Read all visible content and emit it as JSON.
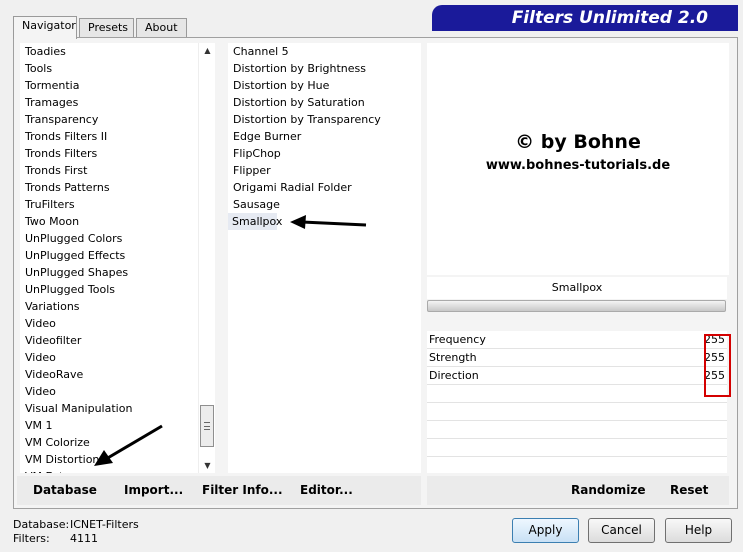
{
  "banner": {
    "title": "Filters Unlimited 2.0"
  },
  "tabs": [
    "Navigator",
    "Presets",
    "About"
  ],
  "categories": [
    "Toadies",
    "Tools",
    "Tormentia",
    "Tramages",
    "Transparency",
    "Tronds Filters II",
    "Tronds Filters",
    "Tronds First",
    "Tronds Patterns",
    "TruFilters",
    "Two Moon",
    "UnPlugged Colors",
    "UnPlugged Effects",
    "UnPlugged Shapes",
    "UnPlugged Tools",
    "Variations",
    "Video",
    "Videofilter",
    "Video",
    "VideoRave",
    "Video",
    "Visual Manipulation",
    "VM 1",
    "VM Colorize",
    "VM Distortion",
    "VM Extravaganza"
  ],
  "filters": [
    "Channel 5",
    "Distortion by Brightness",
    "Distortion by Hue",
    "Distortion by Saturation",
    "Distortion by Transparency",
    "Edge Burner",
    "FlipChop",
    "Flipper",
    "Origami Radial Folder",
    "Sausage",
    "Smallpox"
  ],
  "selected_filter": "Smallpox",
  "preview": {
    "copyright": "© by Bohne",
    "url": "www.bohnes-tutorials.de"
  },
  "filter_name_display": "Smallpox",
  "params": [
    {
      "label": "Frequency",
      "value": "255"
    },
    {
      "label": "Strength",
      "value": "255"
    },
    {
      "label": "Direction",
      "value": "255"
    }
  ],
  "bottom_left": {
    "database": "Database",
    "import": "Import...",
    "filter_info": "Filter Info...",
    "editor": "Editor..."
  },
  "bottom_right": {
    "randomize": "Randomize",
    "reset": "Reset"
  },
  "status": {
    "database_label": "Database:",
    "database_value": "ICNET-Filters",
    "filters_label": "Filters:",
    "filters_value": "4111"
  },
  "buttons": {
    "apply": "Apply",
    "cancel": "Cancel",
    "help": "Help"
  },
  "colors": {
    "banner": "#1a1a9a",
    "highlight_box": "#d40000",
    "selected_row": "#e6eaf2"
  }
}
